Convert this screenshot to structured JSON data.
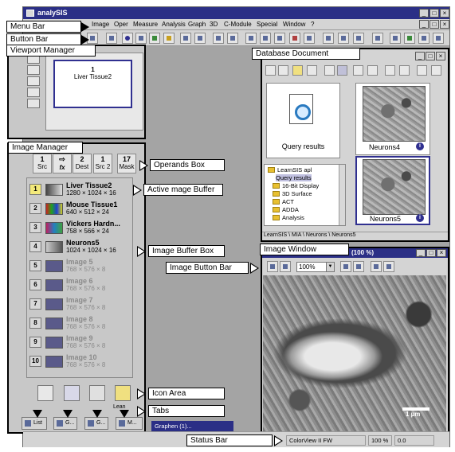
{
  "app": {
    "title": "analySIS"
  },
  "menu": {
    "items": [
      "Image",
      "Oper",
      "Measure",
      "Analysis",
      "Graph",
      "3D",
      "C-Module",
      "Special",
      "Window",
      "?"
    ]
  },
  "window_controls": [
    "_",
    "□",
    "×"
  ],
  "callouts": {
    "menu_bar": "Menu Bar",
    "button_bar": "Button Bar",
    "viewport_manager": "Viewport Manager",
    "image_manager": "Image Manager",
    "operands_box": "Operands Box",
    "active_buffer": "Active mage Buffer",
    "image_buffer_box": "Image Buffer Box",
    "icon_area": "Icon Area",
    "tabs": "Tabs",
    "status_bar": "Status Bar",
    "database_document": "Database Document",
    "image_window": "Image Window",
    "image_button_bar": "Image Button Bar"
  },
  "viewport": {
    "number": "1",
    "name": "Liver Tissue2"
  },
  "operands": [
    {
      "n": "1",
      "label": "Src"
    },
    {
      "n": "⇨",
      "label": "fx"
    },
    {
      "n": "2",
      "label": "Dest"
    },
    {
      "n": "1",
      "label": "Src 2"
    },
    {
      "n": "17",
      "label": "Mask"
    }
  ],
  "buffers": [
    {
      "n": "1",
      "name": "Liver Tissue2",
      "dims": "1280 × 1024 × 16"
    },
    {
      "n": "2",
      "name": "Mouse Tissue1",
      "dims": "640 × 512 × 24"
    },
    {
      "n": "3",
      "name": "Vickers Hardn...",
      "dims": "758 × 566 × 24"
    },
    {
      "n": "4",
      "name": "Neurons5",
      "dims": "1024 × 1024 × 16"
    },
    {
      "n": "5",
      "name": "Image 5",
      "dims": "768 × 576 × 8"
    },
    {
      "n": "6",
      "name": "Image 6",
      "dims": "768 × 576 × 8"
    },
    {
      "n": "7",
      "name": "Image 7",
      "dims": "768 × 576 × 8"
    },
    {
      "n": "8",
      "name": "Image 8",
      "dims": "768 × 576 × 8"
    },
    {
      "n": "9",
      "name": "Image 9",
      "dims": "768 × 576 × 8"
    },
    {
      "n": "10",
      "name": "Image 10",
      "dims": "768 × 576 × 8"
    }
  ],
  "icon_area_label": "Lean",
  "tabs": [
    {
      "label": "List"
    },
    {
      "label": "G..."
    },
    {
      "label": "G..."
    },
    {
      "label": "M..."
    }
  ],
  "taskbar_window": "Graphen (1)...",
  "database": {
    "query_label": "Query results",
    "thumbs": [
      "Neurons4",
      "Neurons5"
    ],
    "tree": [
      "LearnSIS apl",
      "Query results",
      "16-Bit Display",
      "3D Surface",
      "ACT",
      "ADDA",
      "Analysis"
    ],
    "path": "LearnSIS \\ MIA \\ Neurons \\ Neurons5"
  },
  "image_window": {
    "title_suffix": "(100 %)",
    "zoom": "100%",
    "scale_label": "1 µm"
  },
  "status": {
    "camera": "ColorView II FW",
    "zoom": "100 %",
    "value": "0.0"
  }
}
